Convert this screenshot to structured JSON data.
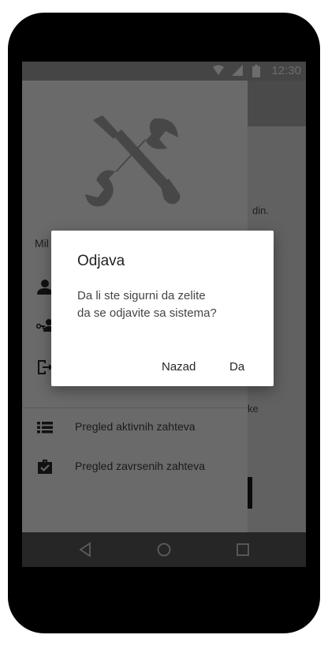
{
  "status_bar": {
    "time": "12:30"
  },
  "drawer": {
    "user_name": "Mil",
    "menu": [
      {
        "icon": "person-icon",
        "label": ""
      },
      {
        "icon": "person-key-icon",
        "label": ""
      },
      {
        "icon": "logout-icon",
        "label": ""
      },
      {
        "icon": "list-icon",
        "label": "Pregled aktivnih zahteva"
      },
      {
        "icon": "briefcase-check-icon",
        "label": "Pregled zavrsenih zahteva"
      }
    ]
  },
  "background_content": {
    "snippet_1": "din.",
    "snippet_2": "ke"
  },
  "dialog": {
    "title": "Odjava",
    "message_line1": "Da li ste sigurni da zelite",
    "message_line2": "da se odjavite sa sistema?",
    "cancel_label": "Nazad",
    "confirm_label": "Da"
  },
  "nav_bar": {
    "back": "back-icon",
    "home": "home-icon",
    "recents": "recents-icon"
  }
}
